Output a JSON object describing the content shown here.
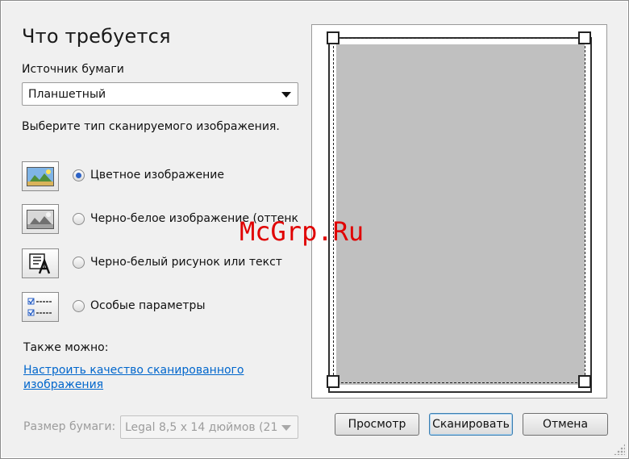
{
  "dialog": {
    "title": "Что требуется",
    "paper_source": {
      "label": "Источник бумаги",
      "value": "Планшетный"
    },
    "scan_type_prompt": "Выберите тип сканируемого изображения.",
    "options": [
      {
        "label": "Цветное изображение",
        "icon": "color-photo-icon",
        "selected": true
      },
      {
        "label": "Черно-белое изображение (оттенк",
        "icon": "grayscale-photo-icon",
        "selected": false
      },
      {
        "label": "Черно-белый рисунок или текст",
        "icon": "bw-text-icon",
        "selected": false
      },
      {
        "label": "Особые параметры",
        "icon": "custom-settings-icon",
        "selected": false
      }
    ],
    "also_label": "Также можно:",
    "quality_link": "Настроить качество сканированного изображения",
    "paper_size": {
      "label": "Размер бумаги:",
      "value": "Legal 8,5 x 14 дюймов (21"
    },
    "buttons": {
      "preview": "Просмотр",
      "scan": "Сканировать",
      "cancel": "Отмена"
    },
    "watermark": "McGrp.Ru"
  },
  "colors": {
    "accent": "#2c62c6",
    "link": "#0066cc",
    "preview_sheet": "#c0c0c0",
    "watermark": "#e00000"
  }
}
